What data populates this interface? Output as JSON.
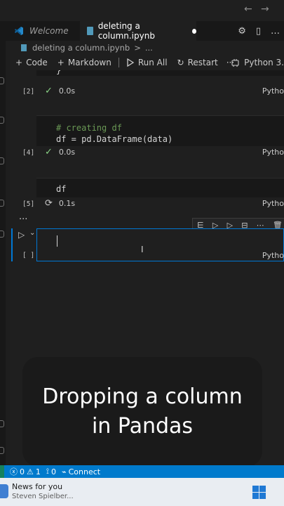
{
  "titlebar": {
    "back": "←",
    "forward": "→"
  },
  "tabs": [
    {
      "label": "Welcome"
    },
    {
      "label": "deleting a column.ipynb"
    }
  ],
  "tab_actions": {
    "settings": "⚙",
    "split": "▯",
    "more": "…"
  },
  "breadcrumb": {
    "file": "deleting a column.ipynb",
    "sep": ">",
    "more": "..."
  },
  "toolbar": {
    "code": "Code",
    "markdown": "Markdown",
    "run_all": "Run All",
    "restart": "Restart",
    "more": "···",
    "kernel": "Python 3."
  },
  "cells": {
    "prev_partial": "}",
    "c2": {
      "count": "[2]",
      "time": "0.0s"
    },
    "c4": {
      "count": "[4]",
      "comment": "# creating df",
      "code": "df = pd.DataFrame(data)",
      "time": "0.0s"
    },
    "c5": {
      "count": "[5]",
      "code": "df",
      "time": "0.1s"
    },
    "lang": "Pytho",
    "ellipsis": "···",
    "active": {
      "count": "[ ]",
      "lang": "Pytho"
    }
  },
  "caption": {
    "line1": "Dropping a column",
    "line2": "in Pandas"
  },
  "statusbar": {
    "errors": "0",
    "warnings": "1",
    "ports": "0",
    "connect": "Connect"
  },
  "taskbar": {
    "news_title": "News for you",
    "news_sub": "Steven Spielber..."
  },
  "colors": {
    "accent": "#0078d4",
    "status_bar": "#007acc",
    "check": "#89d185",
    "comment": "#6a9955"
  }
}
